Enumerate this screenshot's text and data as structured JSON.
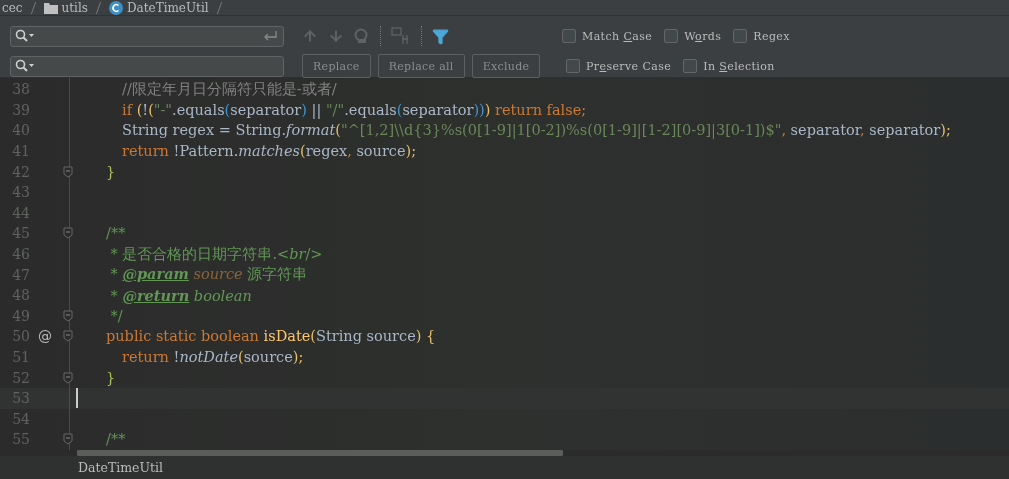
{
  "breadcrumb": [
    {
      "kind": "text",
      "label": "cec"
    },
    {
      "kind": "folder",
      "label": "utils"
    },
    {
      "kind": "class",
      "label": "DateTimeUtil"
    }
  ],
  "find_bar": {
    "buttons": [
      "Replace",
      "Replace all",
      "Exclude"
    ],
    "options_row_1": [
      {
        "label_parts": [
          "Match ",
          "C",
          "ase"
        ],
        "checked": false
      },
      {
        "label_parts": [
          "W",
          "o",
          "rds"
        ],
        "checked": false
      },
      {
        "label_parts": [
          "Regex"
        ],
        "checked": false
      }
    ],
    "options_row_2": [
      {
        "label_parts": [
          "Pr",
          "e",
          "serve Case"
        ],
        "checked": false
      },
      {
        "label_parts": [
          "In ",
          "S",
          "election"
        ],
        "checked": false
      }
    ]
  },
  "editor": {
    "lines": [
      {
        "children": [
          {
            "number": "38",
            "tokens": [
              {
                "kind": "comment",
                "text": "//限定年月日分隔符只能是-或者/"
              }
            ]
          },
          {
            "number": "39",
            "tokens": [
              {
                "kind": "keyword",
                "text": "if "
              },
              {
                "kind": "brace",
                "text": "("
              },
              {
                "kind": "plain",
                "text": "!"
              },
              {
                "kind": "brace",
                "text": "("
              },
              {
                "kind": "string",
                "text": "\"-\""
              },
              {
                "kind": "plain",
                "text": ".equals"
              },
              {
                "kind": "paren",
                "text": "("
              },
              {
                "kind": "plain",
                "text": "separator"
              },
              {
                "kind": "paren",
                "text": ")"
              },
              {
                "kind": "plain",
                "text": " || "
              },
              {
                "kind": "string",
                "text": "\"/\""
              },
              {
                "kind": "plain",
                "text": ".equals"
              },
              {
                "kind": "paren",
                "text": "("
              },
              {
                "kind": "plain",
                "text": "separator"
              },
              {
                "kind": "paren",
                "text": "))"
              },
              {
                "kind": "brace",
                "text": ")"
              },
              {
                "kind": "keyword",
                "text": " return false;"
              }
            ]
          },
          {
            "number": "40",
            "tokens": [
              {
                "kind": "plain",
                "text": "String regex = String."
              },
              {
                "kind": "italic",
                "text": "format"
              },
              {
                "kind": "brace",
                "text": "("
              },
              {
                "kind": "string",
                "text": "\"^[1,2]\\\\d{3}%s(0[1-9]|1[0-2])%s(0[1-9]|[1-2][0-9]|3[0-1])$\""
              },
              {
                "kind": "keyword",
                "text": ","
              },
              {
                "kind": "plain",
                "text": " separator"
              },
              {
                "kind": "keyword",
                "text": ","
              },
              {
                "kind": "plain",
                "text": " separator"
              },
              {
                "kind": "brace",
                "text": ");"
              }
            ]
          },
          {
            "number": "41",
            "tokens": [
              {
                "kind": "keyword",
                "text": "return "
              },
              {
                "kind": "plain",
                "text": "!Pattern."
              },
              {
                "kind": "italic",
                "text": "matches"
              },
              {
                "kind": "brace",
                "text": "("
              },
              {
                "kind": "plain",
                "text": "regex"
              },
              {
                "kind": "keyword",
                "text": ","
              },
              {
                "kind": "plain",
                "text": " source"
              },
              {
                "kind": "brace",
                "text": ");"
              }
            ]
          }
        ]
      },
      {
        "number": "42",
        "fold": true,
        "tokens": [
          {
            "kind": "close",
            "text": "}"
          }
        ]
      },
      {
        "number": "43",
        "fold": false
      },
      {
        "number": "44",
        "fold": false
      },
      {
        "number": "45",
        "fold": true,
        "tokens": [
          {
            "kind": "doc",
            "text": "/**"
          }
        ]
      },
      {
        "number": "46",
        "fold": false,
        "tokens": [
          {
            "kind": "doc",
            "text": " * 是否合格的日期字符串.<"
          },
          {
            "kind": "doc-italic",
            "text": "br"
          },
          {
            "kind": "doc",
            "text": "/>"
          }
        ]
      },
      {
        "number": "47",
        "fold": false,
        "tokens": [
          {
            "kind": "doc",
            "text": " * "
          },
          {
            "kind": "doc-tag",
            "text": "@param"
          },
          {
            "kind": "doc-param",
            "text": " source"
          },
          {
            "kind": "doc",
            "text": " 源字符串"
          }
        ]
      },
      {
        "number": "48",
        "fold": false,
        "tokens": [
          {
            "kind": "doc",
            "text": " * "
          },
          {
            "kind": "doc-tag",
            "text": "@return"
          },
          {
            "kind": "doc-italic",
            "text": " boolean"
          }
        ]
      },
      {
        "number": "49",
        "fold": true,
        "tokens": [
          {
            "kind": "doc",
            "text": " */"
          }
        ]
      },
      {
        "number": "50",
        "fold": true,
        "marker": "@",
        "tokens": [
          {
            "kind": "keyword",
            "text": "public static boolean "
          },
          {
            "kind": "method",
            "text": "isDate"
          },
          {
            "kind": "brace",
            "text": "("
          },
          {
            "kind": "plain",
            "text": "String source"
          },
          {
            "kind": "brace",
            "text": ") {"
          }
        ],
        "children": [
          {
            "number": "51",
            "tokens": [
              {
                "kind": "keyword",
                "text": "return "
              },
              {
                "kind": "plain",
                "text": "!"
              },
              {
                "kind": "italic",
                "text": "notDate"
              },
              {
                "kind": "brace",
                "text": "("
              },
              {
                "kind": "plain",
                "text": "source"
              },
              {
                "kind": "brace",
                "text": ");"
              }
            ]
          }
        ]
      },
      {
        "number": "52",
        "fold": true,
        "tokens": [
          {
            "kind": "close",
            "text": "}"
          }
        ]
      },
      {
        "number": "53",
        "fold": false,
        "current": true
      },
      {
        "number": "54",
        "fold": false
      },
      {
        "number": "55",
        "fold": true,
        "tokens": [
          {
            "kind": "doc",
            "text": "/**"
          }
        ]
      }
    ]
  },
  "status_bar": {
    "label": "DateTimeUtil"
  }
}
